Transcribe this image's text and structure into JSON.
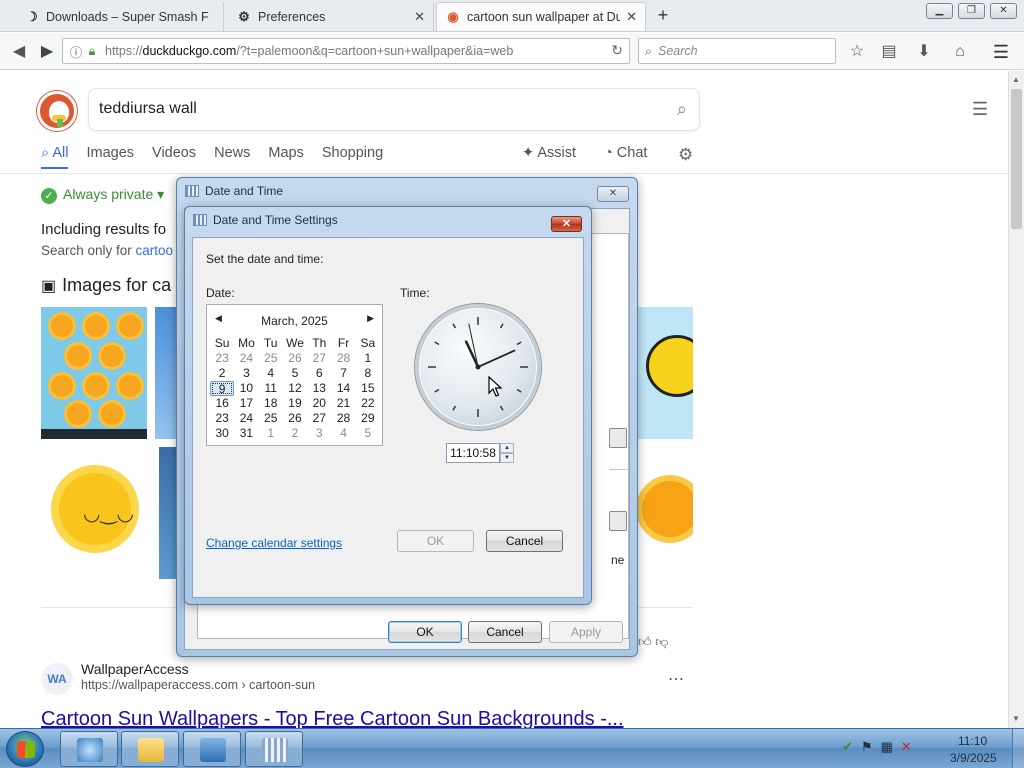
{
  "browser": {
    "tabs": [
      {
        "title": "Downloads – Super Smash F",
        "icon": "pale-moon-icon"
      },
      {
        "title": "Preferences",
        "icon": "gear-icon"
      },
      {
        "title": "cartoon sun wallpaper at Du",
        "icon": "duckduckgo-icon"
      }
    ],
    "url_prefix": "https://",
    "url_domain": "duckduckgo.com",
    "url_path": "/?t=palemoon&q=cartoon+sun+wallpaper&ia=web",
    "search_placeholder": "Search"
  },
  "ddg": {
    "query": "teddiursa wall",
    "verticals": [
      "All",
      "Images",
      "Videos",
      "News",
      "Maps",
      "Shopping"
    ],
    "active_vertical": "All",
    "assist": "Assist",
    "chat": "Chat",
    "always_private": "Always private",
    "including": "Including results fo",
    "search_only_prefix": "Search only for ",
    "search_only_link": "cartoo",
    "images_for": "Images for ca",
    "result": {
      "site": "WallpaperAccess",
      "favicon": "WA",
      "url": "https://wallpaperaccess.com › cartoon-sun",
      "title": "Cartoon Sun Wallpapers - Top Free Cartoon Sun Backgrounds -..."
    }
  },
  "outer_dialog": {
    "title": "Date and Time",
    "ok": "OK",
    "cancel": "Cancel",
    "apply": "Apply",
    "peek_text": "ne"
  },
  "inner_dialog": {
    "title": "Date and Time Settings",
    "prompt": "Set the date and time:",
    "date_label": "Date:",
    "time_label": "Time:",
    "month": "March, 2025",
    "weekdays": [
      "Su",
      "Mo",
      "Tu",
      "We",
      "Th",
      "Fr",
      "Sa"
    ],
    "weeks": [
      [
        "23",
        "24",
        "25",
        "26",
        "27",
        "28",
        "1"
      ],
      [
        "2",
        "3",
        "4",
        "5",
        "6",
        "7",
        "8"
      ],
      [
        "9",
        "10",
        "11",
        "12",
        "13",
        "14",
        "15"
      ],
      [
        "16",
        "17",
        "18",
        "19",
        "20",
        "21",
        "22"
      ],
      [
        "23",
        "24",
        "25",
        "26",
        "27",
        "28",
        "29"
      ],
      [
        "30",
        "31",
        "1",
        "2",
        "3",
        "4",
        "5"
      ]
    ],
    "selected_day": "9",
    "time_value": "11:10:58",
    "change_calendar": "Change calendar settings",
    "ok": "OK",
    "cancel": "Cancel"
  },
  "taskbar": {
    "time": "11:10",
    "date": "3/9/2025"
  }
}
